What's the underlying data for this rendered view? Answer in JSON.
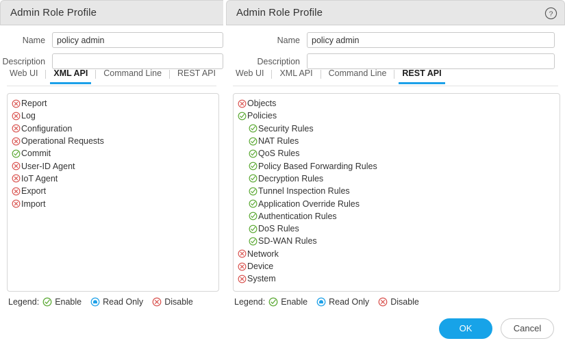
{
  "colors": {
    "enable": "#5aa832",
    "disable": "#d9534f",
    "readonly": "#1ca0e8",
    "accent": "#1ca0e8",
    "primary_button": "#17a3e8",
    "titlebar": "#e7e7e7"
  },
  "footer": {
    "ok_label": "OK",
    "cancel_label": "Cancel"
  },
  "legend": {
    "title": "Legend:",
    "items": [
      {
        "state": "enable",
        "label": "Enable"
      },
      {
        "state": "readonly",
        "label": "Read Only"
      },
      {
        "state": "disable",
        "label": "Disable"
      }
    ]
  },
  "left_panel": {
    "title": "Admin Role Profile",
    "help_icon": "question-mark-circle-icon",
    "fields": {
      "name_label": "Name",
      "name_value": "policy admin",
      "description_label": "Description",
      "description_value": ""
    },
    "tabs": [
      {
        "label": "Web UI",
        "active": false
      },
      {
        "label": "XML API",
        "active": true
      },
      {
        "label": "Command Line",
        "active": false
      },
      {
        "label": "REST API",
        "active": false
      }
    ],
    "tree": [
      {
        "label": "Report",
        "state": "disable",
        "indent": 0
      },
      {
        "label": "Log",
        "state": "disable",
        "indent": 0
      },
      {
        "label": "Configuration",
        "state": "disable",
        "indent": 0
      },
      {
        "label": "Operational Requests",
        "state": "disable",
        "indent": 0
      },
      {
        "label": "Commit",
        "state": "enable",
        "indent": 0
      },
      {
        "label": "User-ID Agent",
        "state": "disable",
        "indent": 0
      },
      {
        "label": "IoT Agent",
        "state": "disable",
        "indent": 0
      },
      {
        "label": "Export",
        "state": "disable",
        "indent": 0
      },
      {
        "label": "Import",
        "state": "disable",
        "indent": 0
      }
    ]
  },
  "right_panel": {
    "title": "Admin Role Profile",
    "help_icon": "question-mark-circle-icon",
    "fields": {
      "name_label": "Name",
      "name_value": "policy admin",
      "description_label": "Description",
      "description_value": ""
    },
    "tabs": [
      {
        "label": "Web UI",
        "active": false
      },
      {
        "label": "XML API",
        "active": false
      },
      {
        "label": "Command Line",
        "active": false
      },
      {
        "label": "REST API",
        "active": true
      }
    ],
    "tree": [
      {
        "label": "Objects",
        "state": "disable",
        "indent": 0
      },
      {
        "label": "Policies",
        "state": "enable",
        "indent": 0
      },
      {
        "label": "Security Rules",
        "state": "enable",
        "indent": 1
      },
      {
        "label": "NAT Rules",
        "state": "enable",
        "indent": 1
      },
      {
        "label": "QoS Rules",
        "state": "enable",
        "indent": 1
      },
      {
        "label": "Policy Based Forwarding Rules",
        "state": "enable",
        "indent": 1
      },
      {
        "label": "Decryption Rules",
        "state": "enable",
        "indent": 1
      },
      {
        "label": "Tunnel Inspection Rules",
        "state": "enable",
        "indent": 1
      },
      {
        "label": "Application Override Rules",
        "state": "enable",
        "indent": 1
      },
      {
        "label": "Authentication Rules",
        "state": "enable",
        "indent": 1
      },
      {
        "label": "DoS Rules",
        "state": "enable",
        "indent": 1
      },
      {
        "label": "SD-WAN Rules",
        "state": "enable",
        "indent": 1
      },
      {
        "label": "Network",
        "state": "disable",
        "indent": 0
      },
      {
        "label": "Device",
        "state": "disable",
        "indent": 0
      },
      {
        "label": "System",
        "state": "disable",
        "indent": 0
      }
    ]
  }
}
